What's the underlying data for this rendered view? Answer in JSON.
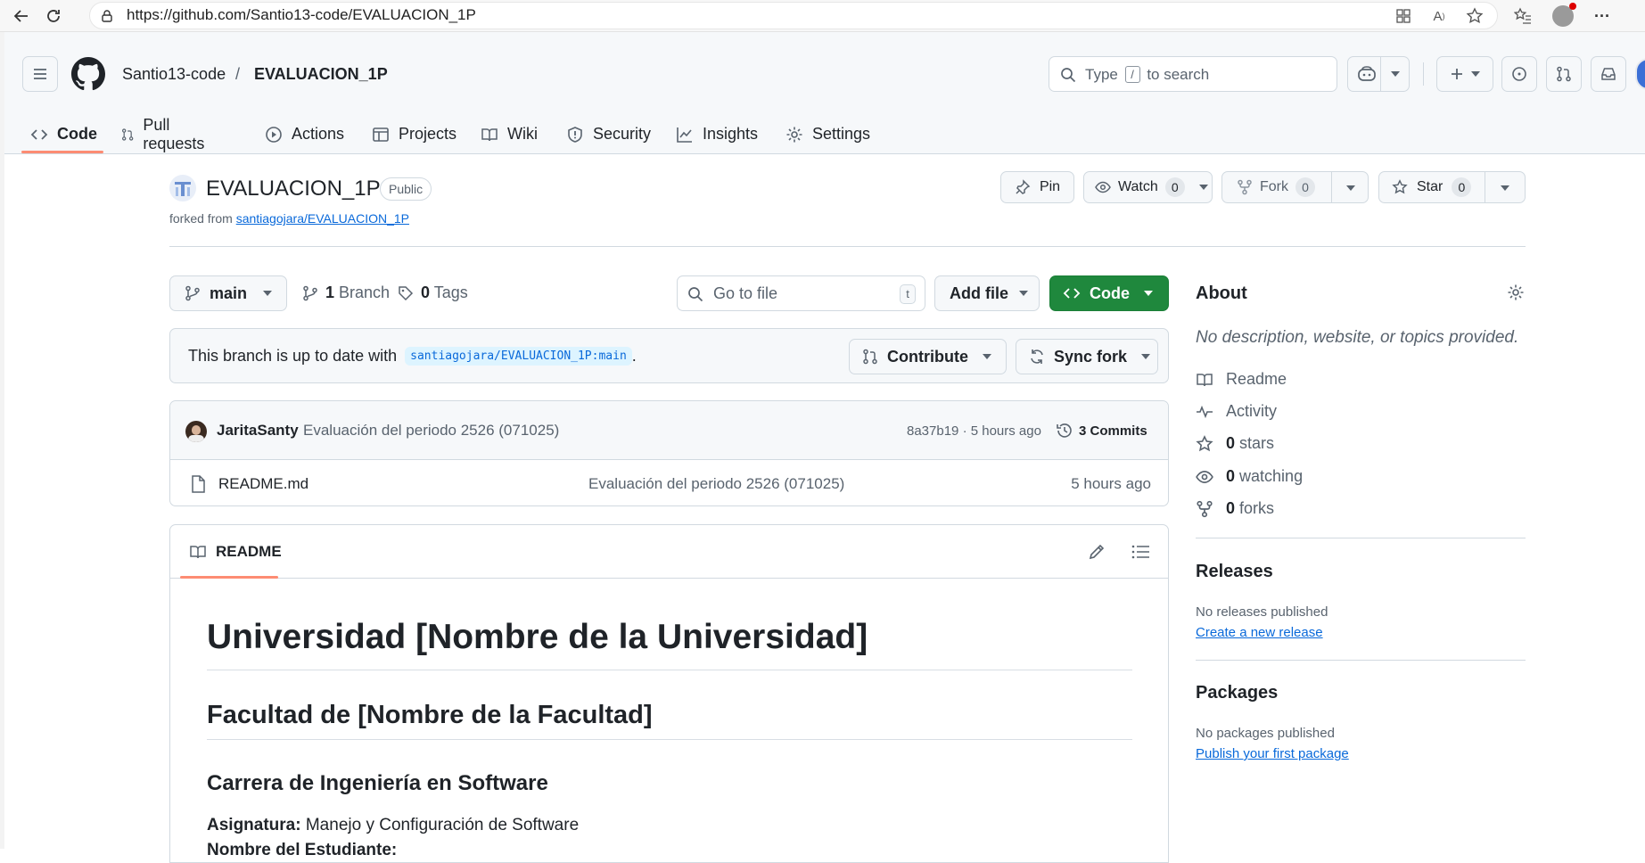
{
  "browser": {
    "url": "https://github.com/Santio13-code/EVALUACION_1P"
  },
  "header": {
    "owner": "Santio13-code",
    "separator": "/",
    "repo": "EVALUACION_1P",
    "search_prefix": "Type",
    "search_key": "/",
    "search_suffix": "to search"
  },
  "tabs": [
    {
      "label": "Code",
      "icon": "code-icon"
    },
    {
      "label": "Pull requests",
      "icon": "git-pull-request-icon"
    },
    {
      "label": "Actions",
      "icon": "play-icon"
    },
    {
      "label": "Projects",
      "icon": "table-icon"
    },
    {
      "label": "Wiki",
      "icon": "book-icon"
    },
    {
      "label": "Security",
      "icon": "shield-icon"
    },
    {
      "label": "Insights",
      "icon": "graph-icon"
    },
    {
      "label": "Settings",
      "icon": "gear-icon"
    }
  ],
  "repo": {
    "name": "EVALUACION_1P",
    "visibility": "Public",
    "forked_prefix": "forked from",
    "forked_from": "santiagojara/EVALUACION_1P",
    "pin_label": "Pin",
    "watch_label": "Watch",
    "watch_count": "0",
    "fork_label": "Fork",
    "fork_count": "0",
    "star_label": "Star",
    "star_count": "0"
  },
  "filebar": {
    "branch": "main",
    "branch_count": "1",
    "branch_label": "Branch",
    "tag_count": "0",
    "tag_label": "Tags",
    "goto_placeholder": "Go to file",
    "goto_key": "t",
    "add_file": "Add file",
    "code_button": "Code"
  },
  "sync": {
    "message": "This branch is up to date with",
    "ref": "santiagojara/EVALUACION_1P:main",
    "period": ".",
    "contribute": "Contribute",
    "sync_fork": "Sync fork"
  },
  "commit": {
    "author": "JaritaSanty",
    "message": "Evaluación del periodo 2526 (071025)",
    "hash_time": "8a37b19 · 5 hours ago",
    "commits": "3 Commits"
  },
  "files": [
    {
      "name": "README.md",
      "message": "Evaluación del periodo 2526 (071025)",
      "time": "5 hours ago"
    }
  ],
  "readme": {
    "tab_label": "README",
    "h1": "Universidad [Nombre de la Universidad]",
    "h2": "Facultad de [Nombre de la Facultad]",
    "h3": "Carrera de Ingeniería en Software",
    "subject_label": "Asignatura:",
    "subject_value": "Manejo y Configuración de Software",
    "student_label": "Nombre del Estudiante:"
  },
  "about": {
    "title": "About",
    "description": "No description, website, or topics provided.",
    "readme": "Readme",
    "activity": "Activity",
    "stars_count": "0",
    "stars_label": "stars",
    "watching_count": "0",
    "watching_label": "watching",
    "forks_count": "0",
    "forks_label": "forks",
    "releases_title": "Releases",
    "releases_text": "No releases published",
    "releases_link": "Create a new release",
    "packages_title": "Packages",
    "packages_text": "No packages published",
    "packages_link": "Publish your first package"
  },
  "colors": {
    "accent_green": "#1f883d",
    "link_blue": "#0969da",
    "tab_underline": "#fd8c73"
  }
}
